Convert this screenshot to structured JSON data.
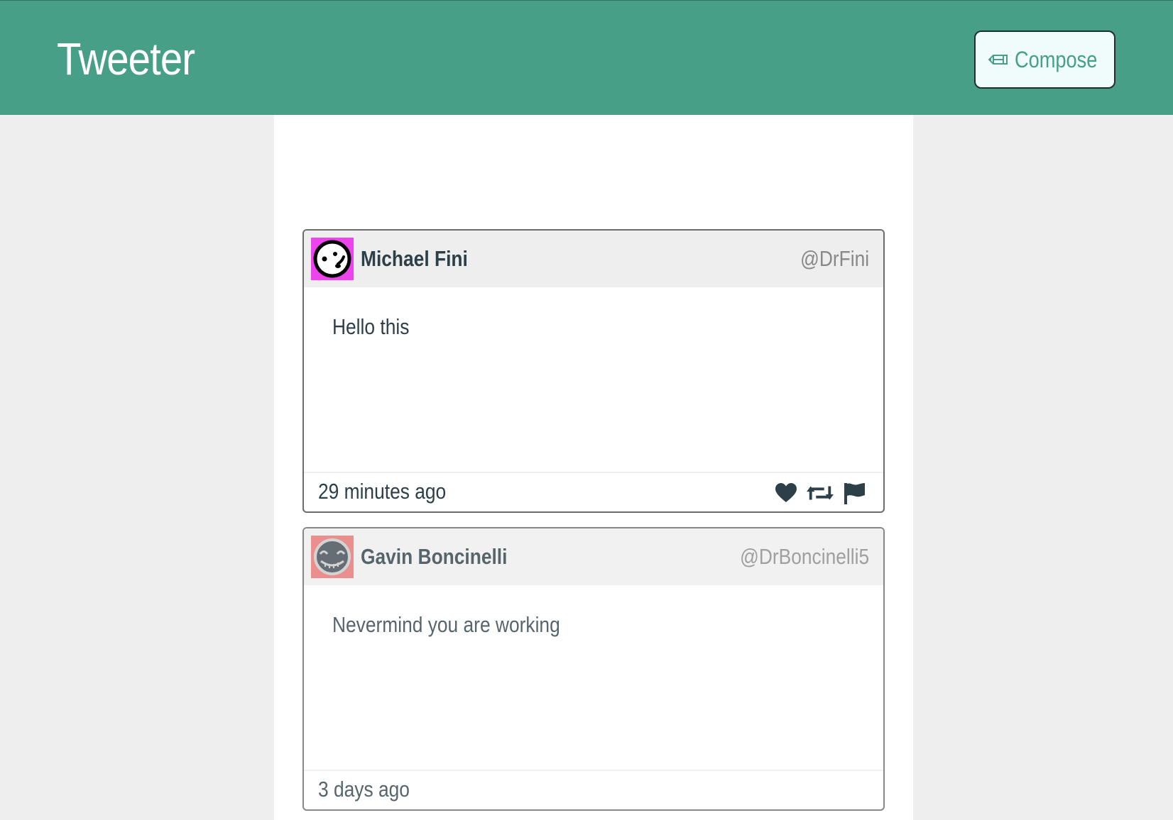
{
  "app": {
    "title": "Tweeter"
  },
  "nav": {
    "compose_label": "Compose",
    "compose_icon": "pencil-icon"
  },
  "colors": {
    "accent": "#479f88",
    "text": "#2d3f48",
    "handle": "#888888",
    "card_header_bg": "#eeeeee"
  },
  "tweets": [
    {
      "name": "Michael Fini",
      "handle": "@DrFini",
      "text": "Hello this",
      "time": "29 minutes ago",
      "avatar_color": "#ee44ee",
      "actions": [
        "heart-icon",
        "retweet-icon",
        "flag-icon"
      ]
    },
    {
      "name": "Gavin Boncinelli",
      "handle": "@DrBoncinelli5",
      "text": "Nevermind you are working",
      "time": "3 days ago",
      "avatar_color": "#e57373"
    }
  ]
}
